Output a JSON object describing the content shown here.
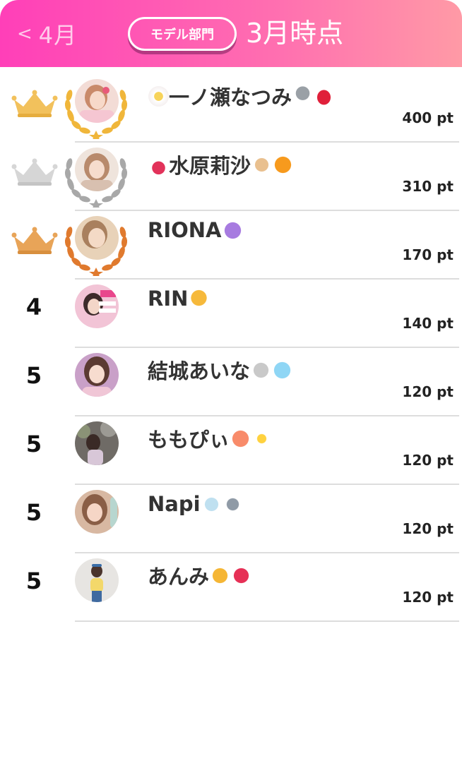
{
  "header": {
    "prev_label": "4月",
    "category": "モデル部門",
    "period": "3月時点"
  },
  "ranking": [
    {
      "rank": "1",
      "name": "一ノ瀬なつみ",
      "emojis": [
        "flower-icon",
        "microphone-icon",
        "lips-icon"
      ],
      "points": "400 pt",
      "medal": "gold"
    },
    {
      "rank": "2",
      "name": "水原莉沙",
      "emojis": [
        "dancer-icon",
        "dog-icon",
        "orange-icon"
      ],
      "points": "310 pt",
      "medal": "silver"
    },
    {
      "rank": "3",
      "name": "RIONA",
      "emojis": [
        "purple-heart-icon"
      ],
      "points": "170 pt",
      "medal": "bronze"
    },
    {
      "rank": "4",
      "name": "RIN",
      "emojis": [
        "bell-icon"
      ],
      "points": "140 pt",
      "medal": ""
    },
    {
      "rank": "5",
      "name": "結城あいな",
      "emojis": [
        "rabbit-icon",
        "light-blue-heart-icon"
      ],
      "points": "120 pt",
      "medal": ""
    },
    {
      "rank": "5",
      "name": "ももぴぃ",
      "emojis": [
        "peach-icon",
        "sparkles-icon"
      ],
      "points": "120 pt",
      "medal": ""
    },
    {
      "rank": "5",
      "name": "Napi",
      "emojis": [
        "angel-icon",
        "classical-building-icon"
      ],
      "points": "120 pt",
      "medal": ""
    },
    {
      "rank": "5",
      "name": "あんみ",
      "emojis": [
        "beer-mugs-icon",
        "two-hearts-icon"
      ],
      "points": "120 pt",
      "medal": ""
    }
  ],
  "colors": {
    "header_start": "#ff3fb8",
    "header_end": "#ff9aa6",
    "gold": "#f2c15c",
    "silver": "#c9c9c9",
    "bronze": "#e8a458"
  }
}
